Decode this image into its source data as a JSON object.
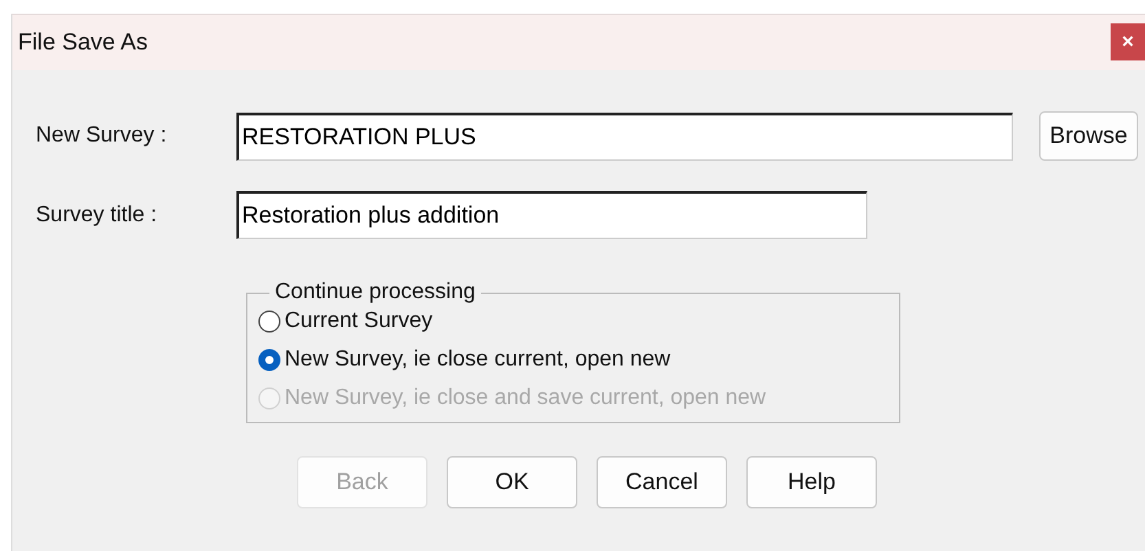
{
  "window": {
    "title": "File Save As",
    "close": "×"
  },
  "fields": [
    {
      "label": "New Survey :",
      "value": "RESTORATION PLUS",
      "kind": "wide"
    },
    {
      "label": "Survey title :",
      "value": "Restoration plus addition",
      "kind": "narrow"
    }
  ],
  "browse_button": "Browse",
  "group": {
    "title": "Continue processing",
    "options": [
      {
        "label": "Current Survey",
        "selected": false,
        "disabled": false
      },
      {
        "label": "New Survey, ie close current, open new",
        "selected": true,
        "disabled": false
      },
      {
        "label": "New Survey, ie close and save current, open new",
        "selected": false,
        "disabled": true
      }
    ]
  },
  "buttons": [
    {
      "label": "Back",
      "disabled": true
    },
    {
      "label": "OK",
      "disabled": false
    },
    {
      "label": "Cancel",
      "disabled": false
    },
    {
      "label": "Help",
      "disabled": false
    }
  ]
}
